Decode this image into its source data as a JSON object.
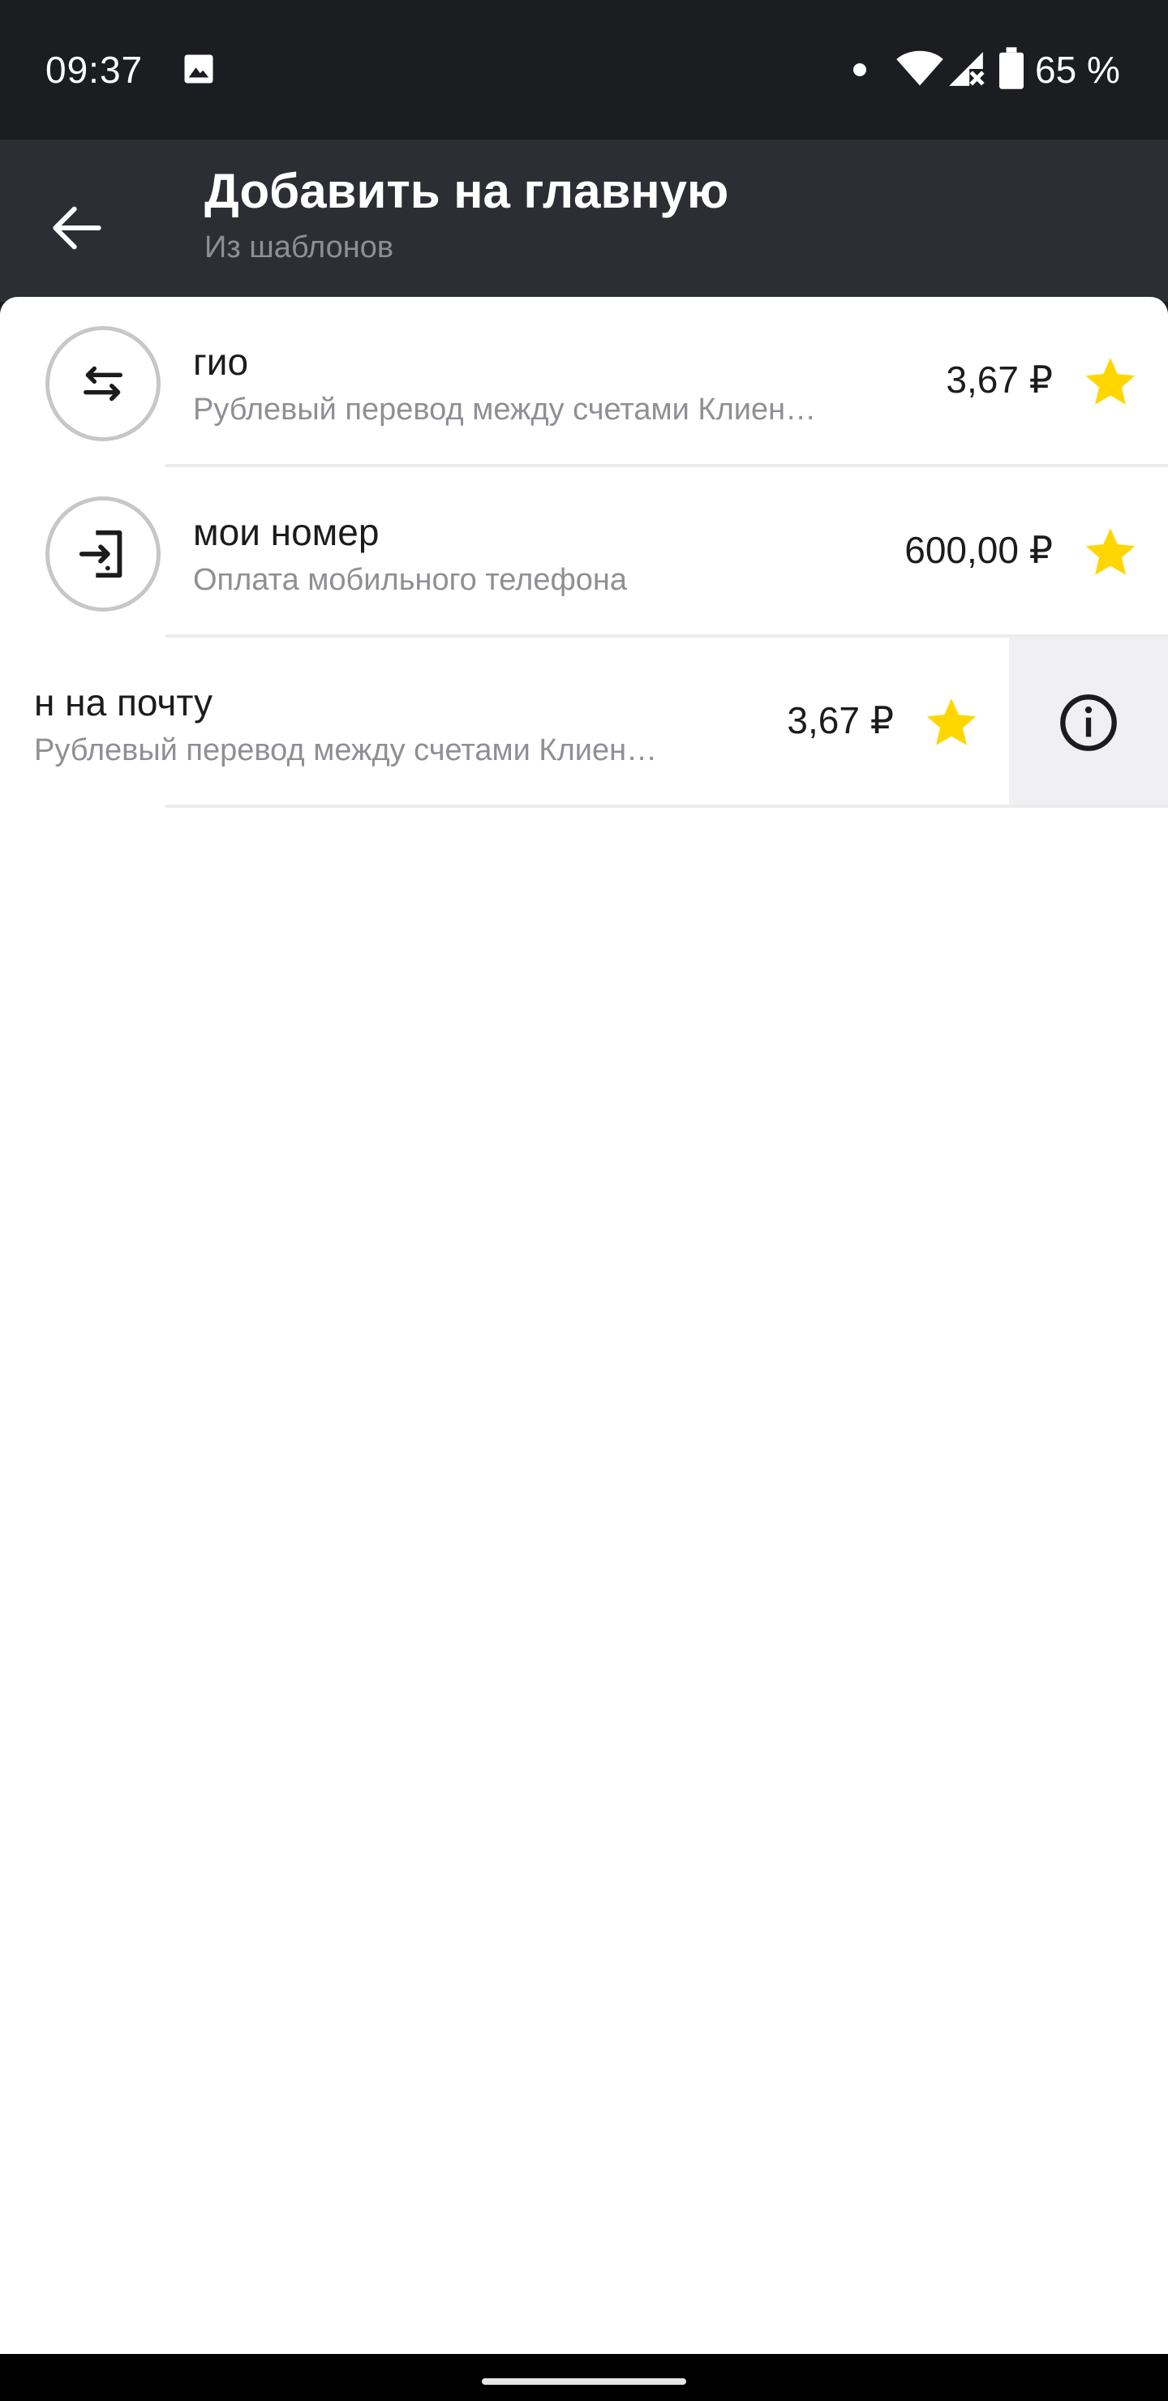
{
  "status_bar": {
    "time": "09:37",
    "battery": "65 %",
    "icons": [
      "gallery-icon",
      "notification-dot-icon",
      "wifi-icon",
      "signal-icon",
      "battery-icon"
    ]
  },
  "app_bar": {
    "back_icon": "arrow-left-icon",
    "title": "Добавить на главную",
    "subtitle": "Из шаблонов"
  },
  "templates": [
    {
      "icon": "transfer-arrows-icon",
      "title": "гио",
      "subtitle": "Рублевый перевод между счетами Клиен…",
      "amount": "3,67 ₽",
      "favorite": true
    },
    {
      "icon": "phone-payment-icon",
      "title": "мои номер",
      "subtitle": "Оплата мобильного телефона",
      "amount": "600,00 ₽",
      "favorite": true
    },
    {
      "icon": "transfer-arrows-icon",
      "title": "н на почту",
      "subtitle": "Рублевый перевод между счетами Клиен…",
      "amount": "3,67 ₽",
      "favorite": true,
      "swiped": true,
      "swipe_action_icon": "info-icon"
    }
  ],
  "colors": {
    "header_background": "#2d2e33",
    "status_bar_background": "#1c1d21",
    "star": "#ffd600",
    "content_background": "#ffffff",
    "subtitle_text": "#8f9096",
    "swipe_action_background": "#f0f0f2"
  }
}
